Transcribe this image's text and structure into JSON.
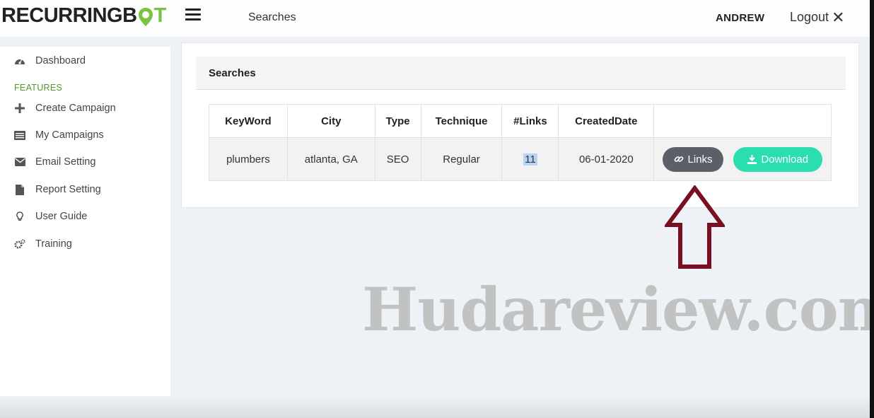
{
  "app": {
    "logo_text_1": "RECURRINGB",
    "logo_text_2": "T",
    "page_title": "Searches",
    "user_name": "ANDREW",
    "logout_label": "Logout",
    "brand_green": "#7cc242"
  },
  "sidebar": {
    "section_label": "FEATURES",
    "items": [
      {
        "label": "Dashboard",
        "icon": "dashboard-icon"
      },
      {
        "label": "Create Campaign",
        "icon": "plus-icon"
      },
      {
        "label": "My Campaigns",
        "icon": "list-icon"
      },
      {
        "label": "Email Setting",
        "icon": "envelope-icon"
      },
      {
        "label": "Report Setting",
        "icon": "file-icon"
      },
      {
        "label": "User Guide",
        "icon": "lightbulb-icon"
      },
      {
        "label": "Training",
        "icon": "gears-icon"
      }
    ]
  },
  "main": {
    "panel_title": "Searches",
    "table": {
      "columns": [
        "KeyWord",
        "City",
        "Type",
        "Technique",
        "#Links",
        "CreatedDate",
        ""
      ],
      "rows": [
        {
          "keyword": "plumbers",
          "city": "atlanta, GA",
          "type": "SEO",
          "technique": "Regular",
          "links": "11",
          "created": "06-01-2020",
          "links_button": "Links",
          "download_button": "Download"
        }
      ]
    }
  },
  "overlay": {
    "watermark": "Hudareview.com",
    "arrow_color": "#7a0f24"
  }
}
